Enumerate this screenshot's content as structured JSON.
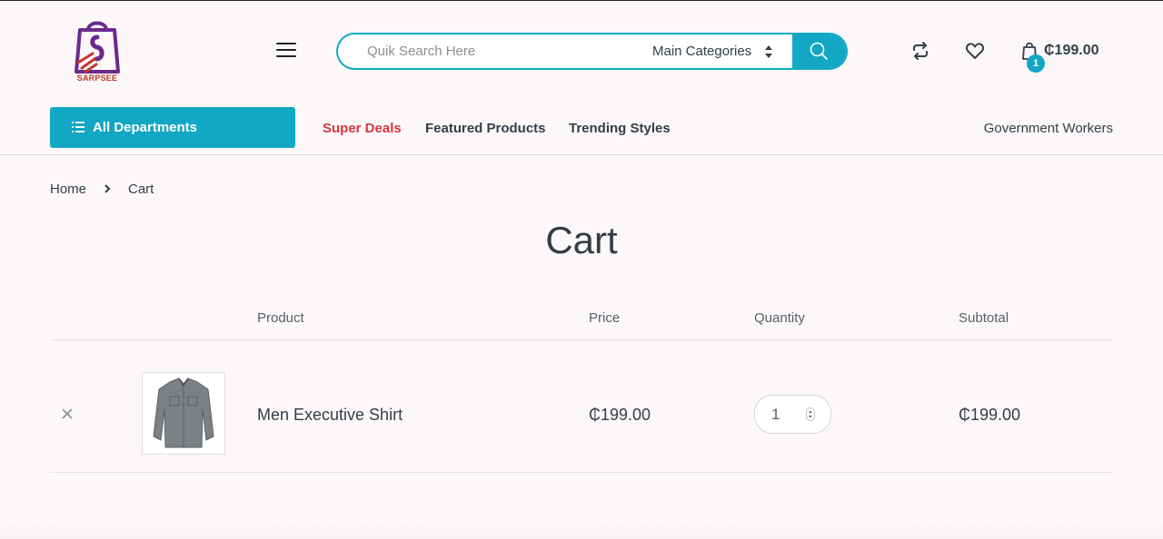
{
  "brand": {
    "logo_text": "SARPSEE",
    "colors": {
      "accent": "#12a7c4",
      "deal_red": "#d9363e",
      "logo_purple": "#6b2a8c",
      "logo_red": "#c0392b"
    }
  },
  "header": {
    "search_placeholder": "Quik Search Here",
    "category_select": "Main Categories",
    "cart_count": "1",
    "cart_total": "₵199.00",
    "icons": [
      "menu-icon",
      "search-icon",
      "compare-icon",
      "heart-icon",
      "shopping-bag-icon"
    ]
  },
  "nav": {
    "departments_label": "All Departments",
    "links": [
      "Super Deals",
      "Featured Products",
      "Trending Styles"
    ],
    "right_link": "Government Workers"
  },
  "breadcrumb": {
    "home": "Home",
    "current": "Cart"
  },
  "page": {
    "title": "Cart"
  },
  "cart_table": {
    "headers": {
      "product": "Product",
      "price": "Price",
      "quantity": "Quantity",
      "subtotal": "Subtotal"
    },
    "rows": [
      {
        "name": "Men Executive Shirt",
        "price": "₵199.00",
        "quantity": "1",
        "subtotal": "₵199.00",
        "image_icon": "grey-shirt-image"
      }
    ]
  }
}
